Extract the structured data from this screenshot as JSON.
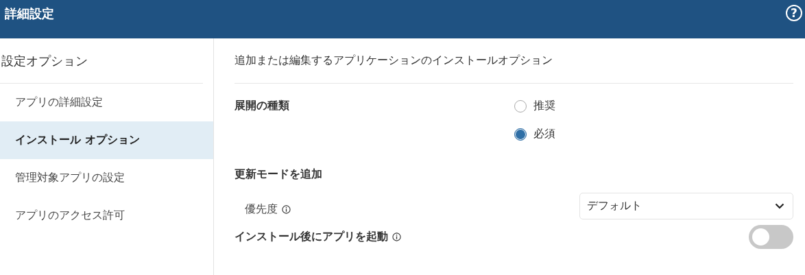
{
  "header": {
    "title": "詳細設定",
    "help": "?"
  },
  "sidebar": {
    "title": "設定オプション",
    "items": [
      {
        "label": "アプリの詳細設定",
        "selected": false
      },
      {
        "label": "インストール オプション",
        "selected": true
      },
      {
        "label": "管理対象アプリの設定",
        "selected": false
      },
      {
        "label": "アプリのアクセス許可",
        "selected": false
      }
    ]
  },
  "main": {
    "description": "追加または編集するアプリケーションのインストールオプション",
    "deployment": {
      "label": "展開の種類",
      "options": [
        {
          "label": "推奨",
          "selected": false
        },
        {
          "label": "必須",
          "selected": true
        }
      ]
    },
    "update_mode": {
      "label": "更新モードを追加"
    },
    "priority": {
      "label": "優先度",
      "value": "デフォルト"
    },
    "launch": {
      "label": "インストール後にアプリを起動",
      "on": false
    }
  }
}
